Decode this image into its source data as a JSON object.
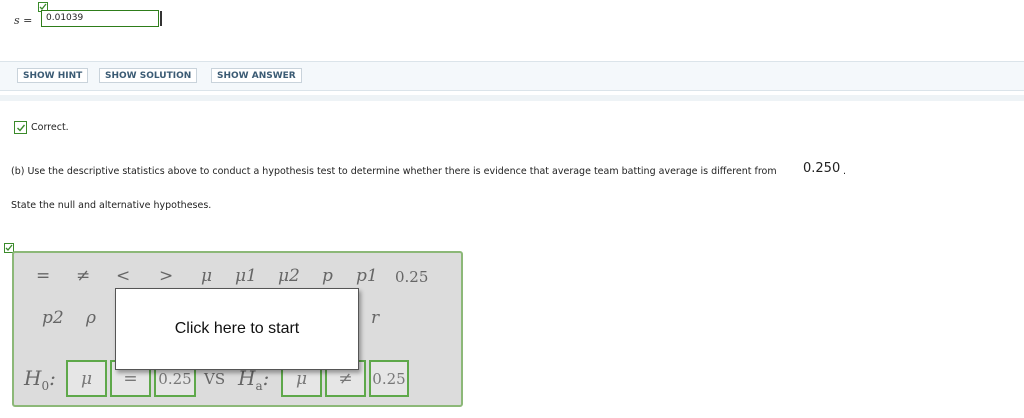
{
  "answer": {
    "label": "s =",
    "value": "0.01039"
  },
  "hints": {
    "hint": "SHOW HINT",
    "solution": "SHOW SOLUTION",
    "answer": "SHOW ANSWER"
  },
  "feedback": {
    "correct": "Correct."
  },
  "question": {
    "text": "(b) Use the descriptive statistics above to conduct a hypothesis test to determine whether there is evidence that average team batting average is different from",
    "value": "0.250",
    "period": ".",
    "instruction": "State the null and alternative hypotheses."
  },
  "palette": {
    "row1": [
      "=",
      "≠",
      "<",
      ">",
      "μ",
      "μ1",
      "μ2",
      "p",
      "p1",
      "0.25"
    ],
    "row2": [
      "p2",
      "ρ",
      "r"
    ]
  },
  "hypothesis": {
    "h0_label": "H0",
    "h0_slots": [
      "μ",
      "=",
      "0.25"
    ],
    "vs_label": "VS",
    "ha_label": "Ha",
    "ha_slots": [
      "μ",
      "≠",
      "0.25"
    ]
  },
  "popup": {
    "text": "Click here to start"
  },
  "colors": {
    "correct_green": "#3a8a2a",
    "slot_border": "#5ea84a",
    "widget_bg": "#dcdcdc"
  }
}
